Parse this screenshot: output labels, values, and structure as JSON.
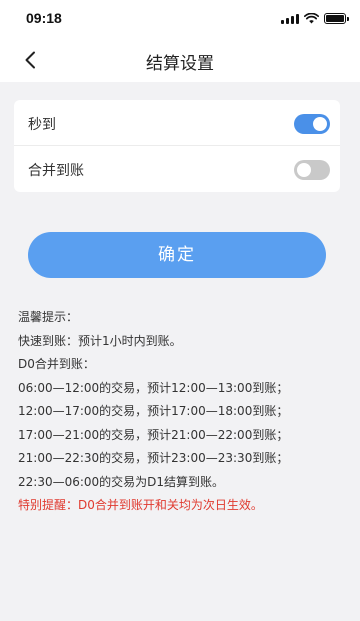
{
  "status_bar": {
    "time": "09:18",
    "icons": [
      "signal-icon",
      "wifi-icon",
      "battery-icon"
    ]
  },
  "nav": {
    "back_icon": "chevron-left-icon",
    "title": "结算设置"
  },
  "settings": {
    "items": [
      {
        "label": "秒到",
        "enabled": true
      },
      {
        "label": "合并到账",
        "enabled": false
      }
    ]
  },
  "confirm": {
    "label": "确定"
  },
  "tips": {
    "lines": [
      "温馨提示：",
      "快速到账：预计1小时内到账。",
      "D0合并到账：",
      "06:00—12:00的交易，预计12:00—13:00到账；",
      "12:00—17:00的交易，预计17:00—18:00到账；",
      "17:00—21:00的交易，预计21:00—22:00到账；",
      "21:00—22:30的交易，预计23:00—23:30到账；",
      "22:30—06:00的交易为D1结算到账。"
    ],
    "warning": "特别提醒：D0合并到账开和关均为次日生效。"
  },
  "colors": {
    "accent": "#4a90e8",
    "button": "#5a9ff0",
    "warning": "#e03a2f",
    "toggle_off": "#c9c9c9"
  }
}
